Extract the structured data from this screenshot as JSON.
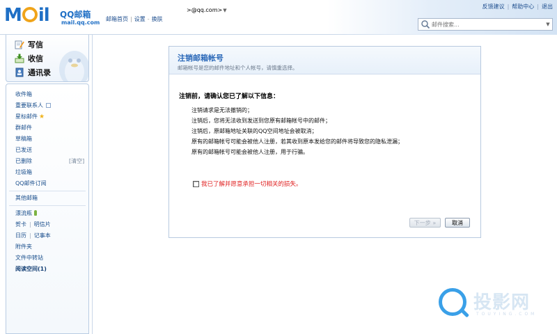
{
  "header": {
    "logo_text": "Mail",
    "logo_brand": "QQ邮箱",
    "logo_domain": "mail.qq.com",
    "nav": [
      "邮箱首页",
      "设置",
      "换肤"
    ],
    "user_email": ">@qq.com>",
    "top_links": [
      "反馈建议",
      "帮助中心",
      "退出"
    ],
    "search_placeholder": "邮件搜索..."
  },
  "sidebar": {
    "actions": [
      "写信",
      "收信",
      "通讯录"
    ],
    "folders": {
      "inbox": "收件箱",
      "vip": "重要联系人",
      "starred": "星标邮件",
      "group": "群邮件",
      "drafts": "草稿箱",
      "sent": "已发送",
      "deleted": "已删除",
      "deleted_clear": "[清空]",
      "spam": "垃圾箱",
      "subscription": "QQ邮件订阅",
      "other": "其他邮箱",
      "bottle": "漂流瓶",
      "card": "贺卡",
      "postcard": "明信片",
      "calendar": "日历",
      "notepad": "记事本",
      "attachments": "附件夹",
      "file_transfer": "文件中转站",
      "reading_space": "阅读空间(1)"
    }
  },
  "panel": {
    "title": "注销邮箱帐号",
    "subtitle": "邮箱帐号是您的邮件地址和个人帐号，请慎重选择。",
    "confirm_heading": "注销前，请确认您已了解以下信息：",
    "notices": [
      "注销请求是无法撤销的；",
      "注销后，您将无法收到发送到您原有邮箱帐号中的邮件；",
      "注销后，原邮箱地址关联的QQ空间地址会被取消；",
      "原有的邮箱帐号可能会被他人注册，若其收到原本发给您的邮件将导致您的隐私泄漏；",
      "原有的邮箱帐号可能会被他人注册，用于行骗。"
    ],
    "agree_label": "我已了解并愿意承担一切相关的损失。",
    "agree_checked": false,
    "next_label": "下一步 »",
    "next_disabled": true,
    "cancel_label": "取消"
  },
  "watermark": {
    "text": "投影网",
    "sub": "TOUYING.COM"
  }
}
